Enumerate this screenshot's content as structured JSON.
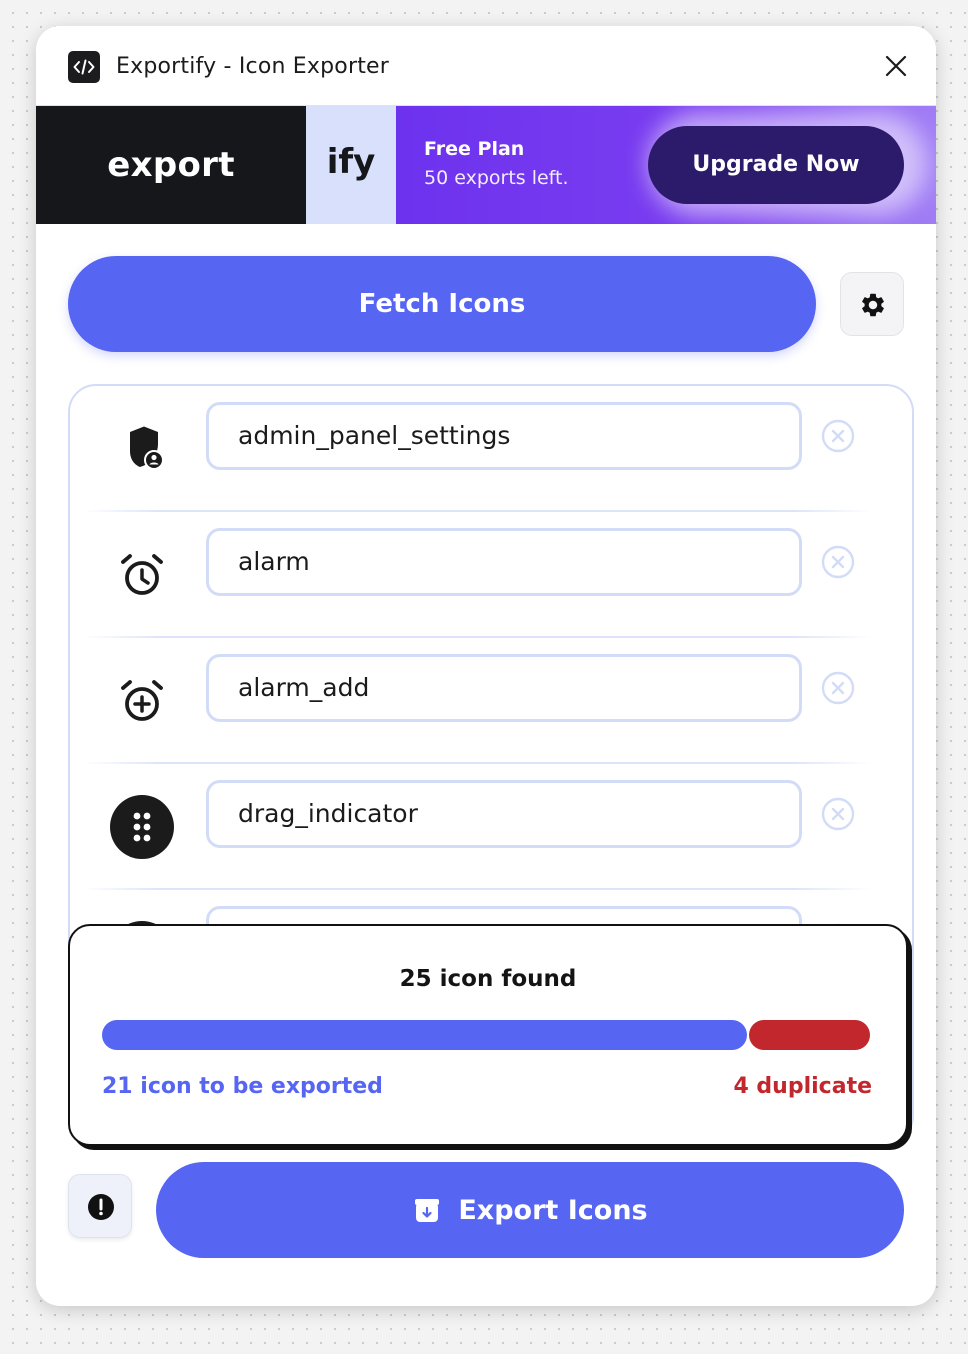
{
  "window": {
    "title": "Exportify - Icon Exporter"
  },
  "banner": {
    "logo_part1": "export",
    "logo_part2": "ify",
    "plan_title": "Free Plan",
    "plan_subtitle": "50 exports left.",
    "upgrade_label": "Upgrade Now"
  },
  "toolbar": {
    "fetch_label": "Fetch Icons",
    "settings_icon": "gear-icon"
  },
  "icon_list": {
    "items": [
      {
        "icon": "admin-panel-settings-icon",
        "value": "admin_panel_settings"
      },
      {
        "icon": "alarm-icon",
        "value": "alarm"
      },
      {
        "icon": "alarm-add-icon",
        "value": "alarm_add"
      },
      {
        "icon": "drag-indicator-icon",
        "value": "drag_indicator"
      },
      {
        "icon": "partially-hidden-icon",
        "value": ""
      }
    ]
  },
  "summary": {
    "title": "25 icon found",
    "export_text": "21 icon to be exported",
    "duplicate_text": "4 duplicate",
    "export_fraction": 0.84,
    "duplicate_fraction": 0.16
  },
  "footer": {
    "info_icon": "exclamation-icon",
    "export_label": "Export Icons",
    "export_icon": "archive-download-icon"
  },
  "colors": {
    "accent": "#5665f2",
    "danger": "#c1272d",
    "banner_dark": "#16171a",
    "banner_light": "#d8e0fb",
    "plan_purple": "#6d32ee",
    "upgrade_dark": "#2c1a6b"
  }
}
